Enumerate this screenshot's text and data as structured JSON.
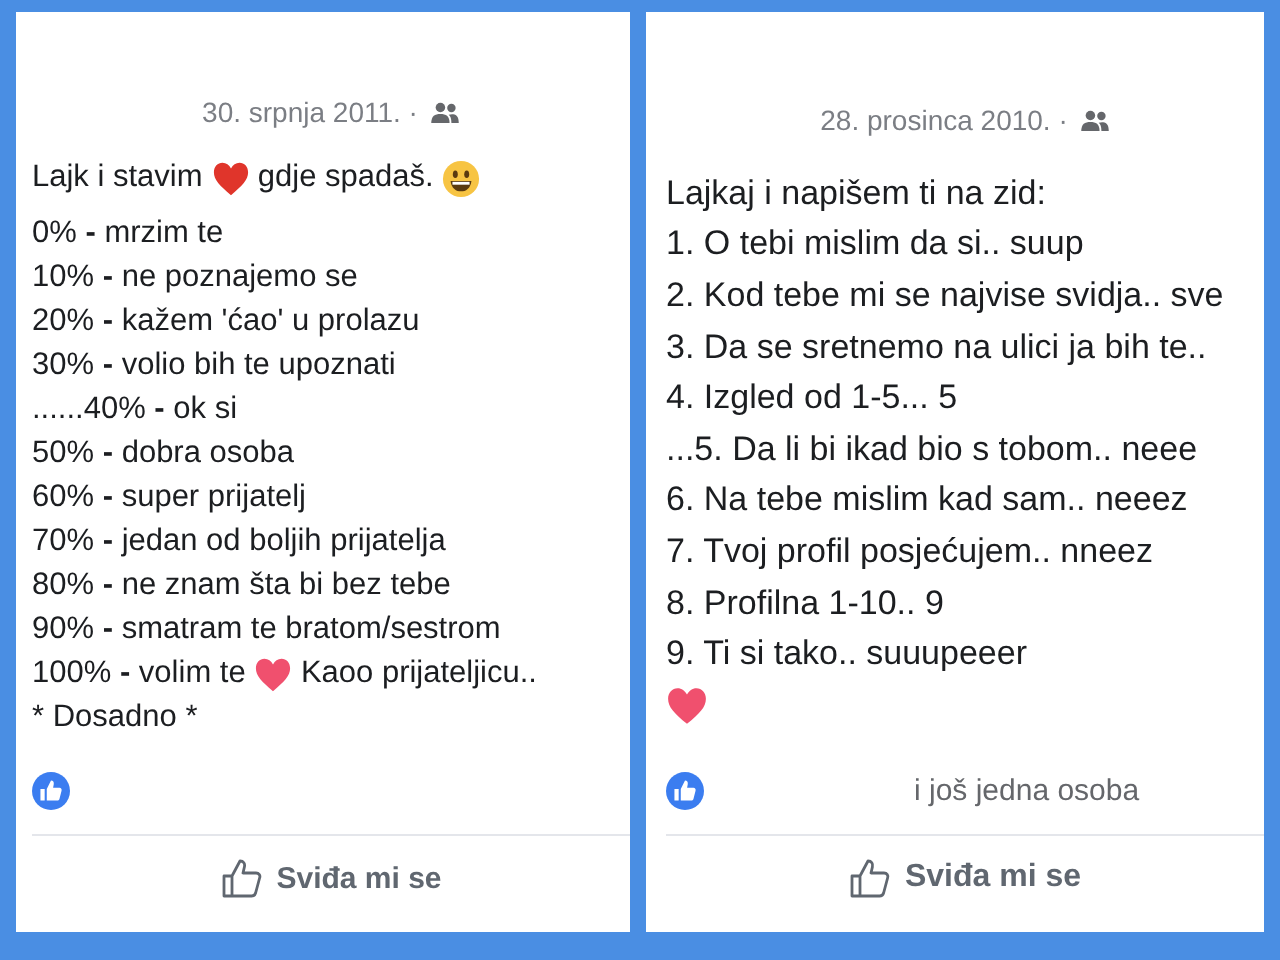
{
  "posts": [
    {
      "date": "30. srpnja 2011. ·",
      "lines": [
        [
          {
            "kind": "text",
            "text": "Lajk i stavim "
          },
          {
            "kind": "heart"
          },
          {
            "kind": "text",
            "text": " gdje spadaš. "
          },
          {
            "kind": "smiley"
          }
        ],
        [
          {
            "kind": "text",
            "text": "0% **-** mrzim te"
          }
        ],
        [
          {
            "kind": "text",
            "text": "10% **-** ne poznajemo se"
          }
        ],
        [
          {
            "kind": "text",
            "text": "20% **-** kažem 'ćao' u prolazu"
          }
        ],
        [
          {
            "kind": "text",
            "text": "30% **-** volio bih te upoznati"
          }
        ],
        [
          {
            "kind": "text",
            "text": "......40% **-** ok si"
          }
        ],
        [
          {
            "kind": "text",
            "text": "50% **-** dobra osoba"
          }
        ],
        [
          {
            "kind": "text",
            "text": "60% **-** super prijatelj"
          }
        ],
        [
          {
            "kind": "text",
            "text": "70% **-** jedan od boljih prijatelja"
          }
        ],
        [
          {
            "kind": "text",
            "text": "80% **-** ne znam šta bi bez tebe"
          }
        ],
        [
          {
            "kind": "text",
            "text": "90% **-** smatram te bratom/sestrom"
          }
        ],
        [
          {
            "kind": "text",
            "text": "100% **-** volim te "
          },
          {
            "kind": "softheart"
          },
          {
            "kind": "text",
            "text": " Kaoo prijateljicu.."
          }
        ],
        [
          {
            "kind": "text",
            "text": "* Dosadno *"
          }
        ]
      ],
      "button": "Sviđa mi se"
    },
    {
      "date": "28. prosinca 2010. ·",
      "lines": [
        [
          {
            "kind": "text",
            "text": "Lajkaj i napišem ti na zid:"
          }
        ],
        [
          {
            "kind": "text",
            "text": "1. O tebi mislim da si.. suup"
          }
        ],
        [
          {
            "kind": "text",
            "text": "2. Kod tebe mi se najvise svidja.. sve"
          }
        ],
        [
          {
            "kind": "text",
            "text": "3. Da se sretnemo na ulici ja bih te.."
          }
        ],
        [
          {
            "kind": "text",
            "text": "4. Izgled od 1-5... 5"
          }
        ],
        [
          {
            "kind": "text",
            "text": "...5. Da li bi ikad bio s tobom.. neee"
          }
        ],
        [
          {
            "kind": "text",
            "text": "6. Na tebe mislim kad sam.. neeez"
          }
        ],
        [
          {
            "kind": "text",
            "text": "7. Tvoj profil posjećujem.. nneez"
          }
        ],
        [
          {
            "kind": "text",
            "text": "8. Profilna 1-10.. 9"
          }
        ],
        [
          {
            "kind": "text",
            "text": "9. Ti si tako.. suuupeeer"
          }
        ],
        [
          {
            "kind": "softheart"
          }
        ]
      ],
      "likes": "i još jedna osoba",
      "button": "Sviđa mi se"
    }
  ]
}
